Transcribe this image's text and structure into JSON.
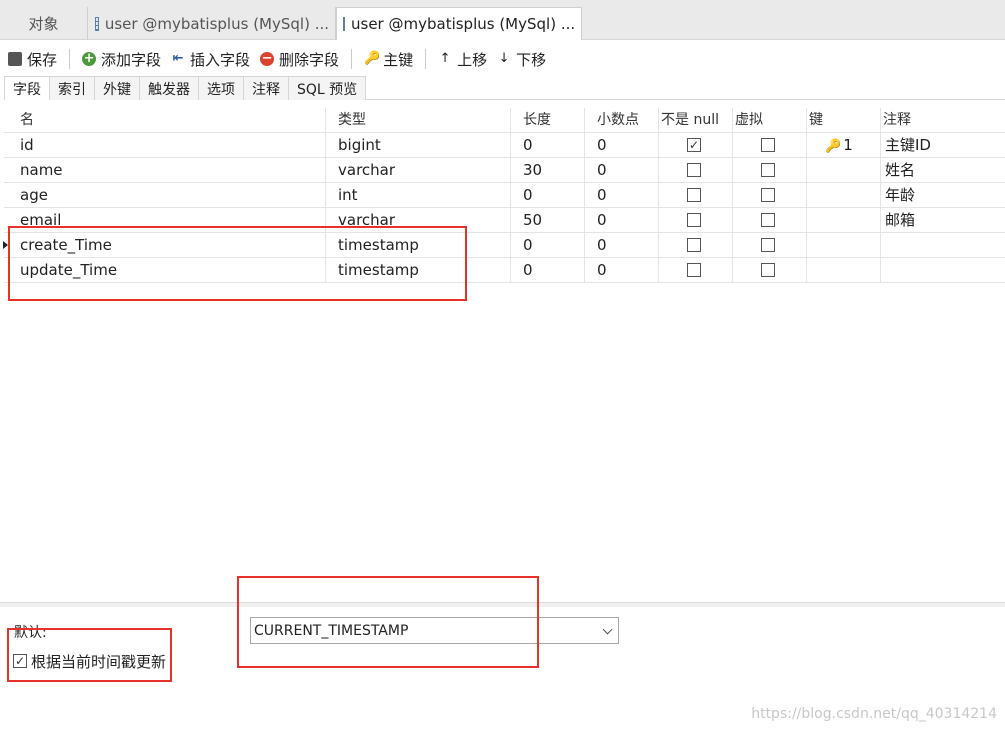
{
  "tabs": [
    {
      "label": "对象",
      "icon": "none"
    },
    {
      "label": "user @mybatisplus (MySql) ...",
      "icon": "table-icon"
    },
    {
      "label": "user @mybatisplus (MySql) ...",
      "icon": "table-edit-icon"
    }
  ],
  "toolbar": {
    "save": "保存",
    "add_field": "添加字段",
    "insert_field": "插入字段",
    "delete_field": "删除字段",
    "primary_key": "主键",
    "move_up": "上移",
    "move_down": "下移"
  },
  "subtabs": [
    "字段",
    "索引",
    "外键",
    "触发器",
    "选项",
    "注释",
    "SQL 预览"
  ],
  "grid": {
    "headers": [
      "名",
      "类型",
      "长度",
      "小数点",
      "不是 null",
      "虚拟",
      "键",
      "注释"
    ],
    "rows": [
      {
        "name": "id",
        "type": "bigint",
        "length": "0",
        "decimals": "0",
        "not_null": true,
        "virtual": false,
        "key": "1",
        "comment": "主键ID"
      },
      {
        "name": "name",
        "type": "varchar",
        "length": "30",
        "decimals": "0",
        "not_null": false,
        "virtual": false,
        "key": "",
        "comment": "姓名"
      },
      {
        "name": "age",
        "type": "int",
        "length": "0",
        "decimals": "0",
        "not_null": false,
        "virtual": false,
        "key": "",
        "comment": "年龄"
      },
      {
        "name": "email",
        "type": "varchar",
        "length": "50",
        "decimals": "0",
        "not_null": false,
        "virtual": false,
        "key": "",
        "comment": "邮箱"
      },
      {
        "name": "create_Time",
        "type": "timestamp",
        "length": "0",
        "decimals": "0",
        "not_null": false,
        "virtual": false,
        "key": "",
        "comment": ""
      },
      {
        "name": "update_Time",
        "type": "timestamp",
        "length": "0",
        "decimals": "0",
        "not_null": false,
        "virtual": false,
        "key": "",
        "comment": ""
      }
    ]
  },
  "bottom": {
    "default_label": "默认:",
    "default_value": "CURRENT_TIMESTAMP",
    "update_checkbox_label": "根据当前时间戳更新",
    "update_checkbox_checked": true
  },
  "watermark": "https://blog.csdn.net/qq_40314214",
  "colors": {
    "annotation": "#e5332a",
    "key": "#d4a017"
  }
}
